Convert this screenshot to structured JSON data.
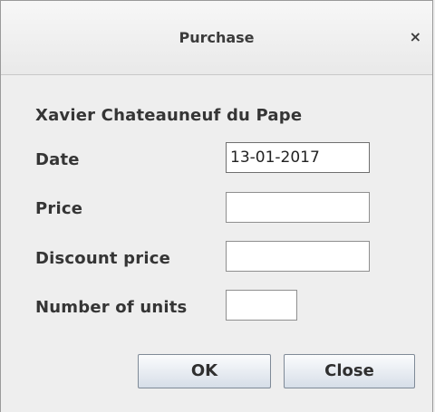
{
  "dialog": {
    "title": "Purchase",
    "close_glyph": "×",
    "product_name": "Xavier Chateauneuf du Pape"
  },
  "form": {
    "date_label": "Date",
    "date_value": "13-01-2017",
    "price_label": "Price",
    "price_value": "",
    "discount_label": "Discount price",
    "discount_value": "",
    "units_label": "Number of units",
    "units_value": ""
  },
  "buttons": {
    "ok_label": "OK",
    "close_label": "Close"
  }
}
